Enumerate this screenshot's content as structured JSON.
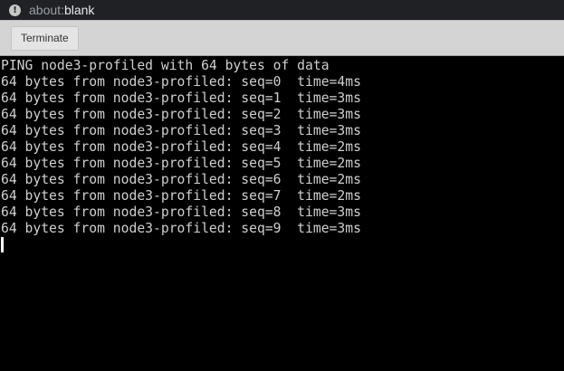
{
  "address_bar": {
    "info_icon": "info-icon",
    "url_scheme": "about:",
    "url_host": "blank"
  },
  "toolbar": {
    "terminate_label": "Terminate"
  },
  "terminal": {
    "lines": [
      "PING node3-profiled with 64 bytes of data",
      "64 bytes from node3-profiled: seq=0  time=4ms",
      "64 bytes from node3-profiled: seq=1  time=3ms",
      "64 bytes from node3-profiled: seq=2  time=3ms",
      "64 bytes from node3-profiled: seq=3  time=3ms",
      "64 bytes from node3-profiled: seq=4  time=2ms",
      "64 bytes from node3-profiled: seq=5  time=2ms",
      "64 bytes from node3-profiled: seq=6  time=2ms",
      "64 bytes from node3-profiled: seq=7  time=2ms",
      "64 bytes from node3-profiled: seq=8  time=3ms",
      "64 bytes from node3-profiled: seq=9  time=3ms"
    ]
  }
}
